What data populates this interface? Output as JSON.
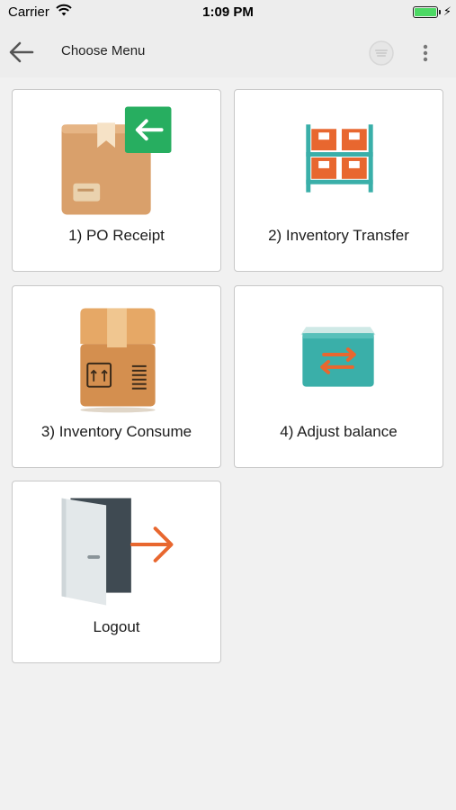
{
  "status_bar": {
    "carrier": "Carrier",
    "time": "1:09 PM"
  },
  "header": {
    "title": "Choose Menu"
  },
  "menu": [
    {
      "label": "1) PO Receipt",
      "icon": "po-receipt-box-icon"
    },
    {
      "label": "2) Inventory Transfer",
      "icon": "inventory-shelf-icon"
    },
    {
      "label": "3) Inventory Consume",
      "icon": "cardboard-box-icon"
    },
    {
      "label": "4) Adjust balance",
      "icon": "adjust-balance-icon"
    },
    {
      "label": "Logout",
      "icon": "logout-door-icon"
    }
  ],
  "colors": {
    "background": "#f1f1f1",
    "toolbar": "#ededed",
    "tile_border": "#c8c8c8",
    "accent_green": "#27ae60",
    "accent_orange": "#e8672f",
    "accent_teal": "#3aafa9",
    "box_brown": "#d9a06b"
  }
}
